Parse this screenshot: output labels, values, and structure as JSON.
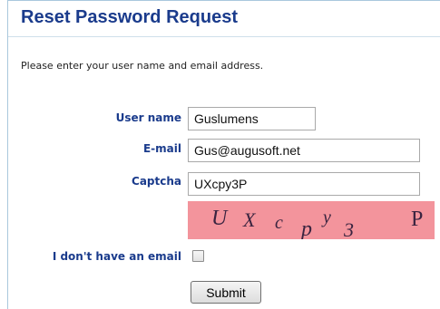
{
  "page": {
    "title": "Reset Password Request",
    "instructions": "Please enter your user name and email address."
  },
  "form": {
    "username_label": "User name",
    "username_value": "Guslumens",
    "email_label": "E-mail",
    "email_value": "Gus@augusoft.net",
    "captcha_label": "Captcha",
    "captcha_value": "UXcpy3P",
    "captcha_image_text": "UXcpy3P",
    "no_email_label": "I don't have an email",
    "no_email_checked": false,
    "submit_label": "Submit"
  },
  "colors": {
    "title": "#1a3b8c",
    "label": "#1a3b8c",
    "captcha_background": "#f3949c",
    "captcha_text": "#3a2440"
  }
}
